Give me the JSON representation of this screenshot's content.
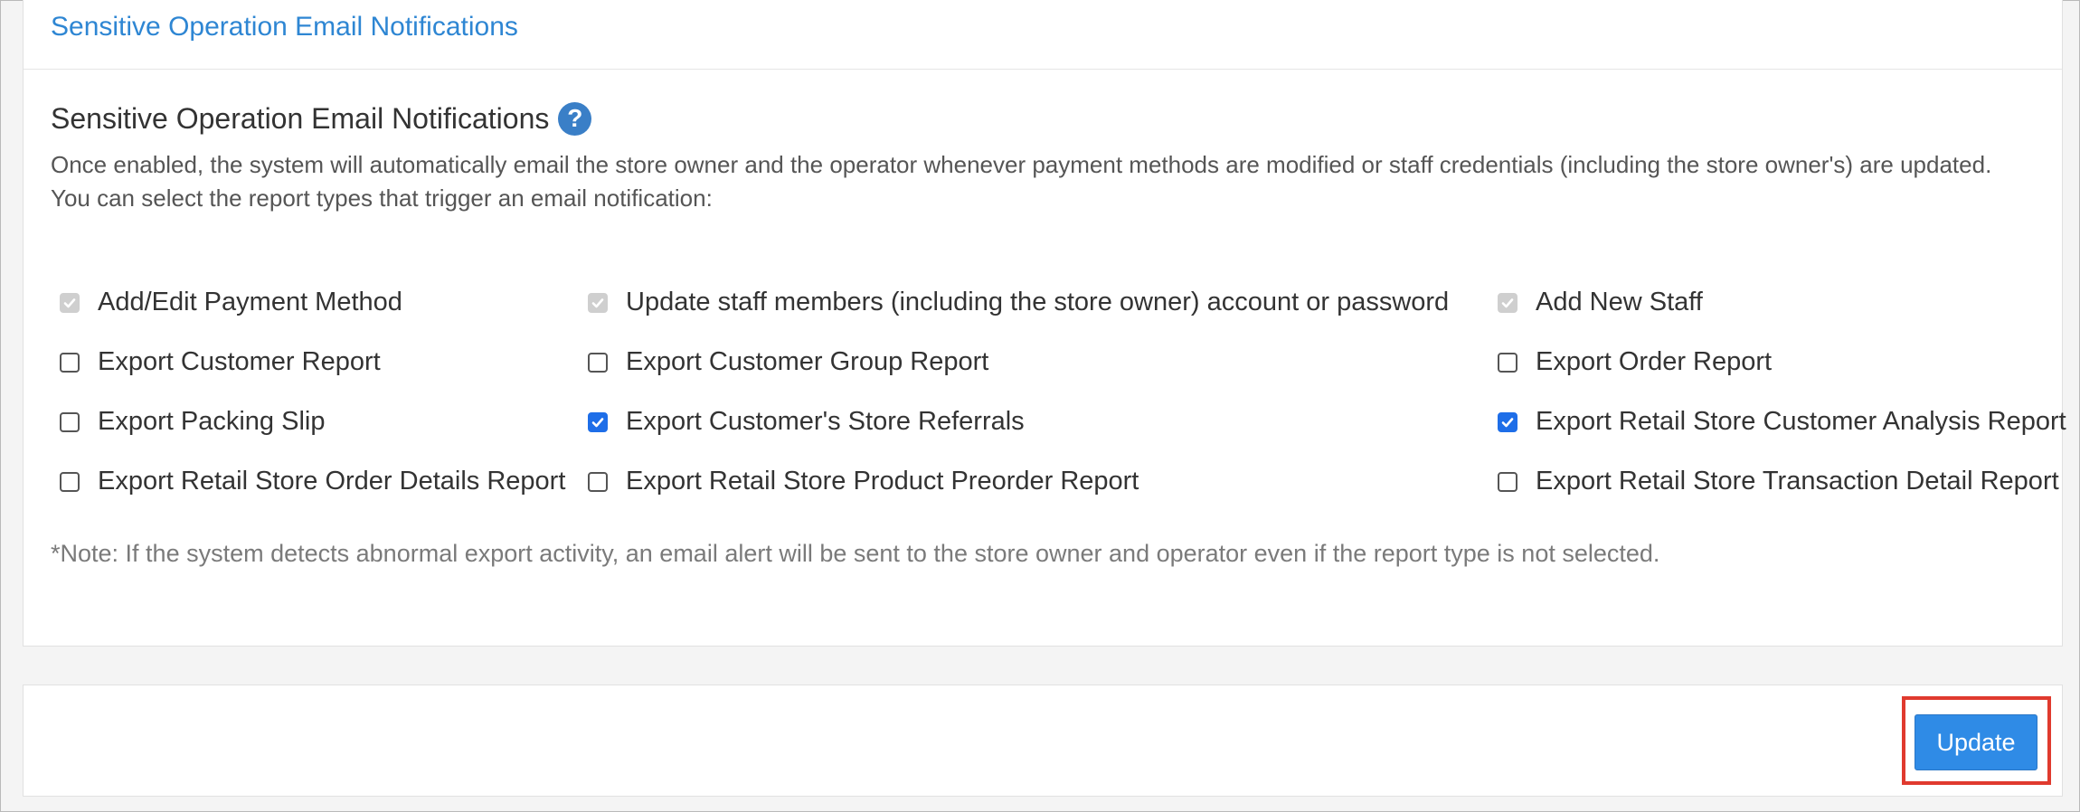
{
  "panel": {
    "title": "Sensitive Operation Email Notifications"
  },
  "section": {
    "title": "Sensitive Operation Email Notifications",
    "help_icon": "question-circle-icon",
    "description_line1": "Once enabled, the system will automatically email the store owner and the operator whenever payment methods are modified or staff credentials (including the store owner's) are updated.",
    "description_line2": "You can select the report types that trigger an email notification:"
  },
  "options": [
    {
      "label": "Add/Edit Payment Method",
      "checked": true,
      "disabled": true
    },
    {
      "label": "Update staff members (including the store owner) account or password",
      "checked": true,
      "disabled": true
    },
    {
      "label": "Add New Staff",
      "checked": true,
      "disabled": true
    },
    {
      "label": "Export Customer Report",
      "checked": false,
      "disabled": false
    },
    {
      "label": "Export Customer Group Report",
      "checked": false,
      "disabled": false
    },
    {
      "label": "Export Order Report",
      "checked": false,
      "disabled": false
    },
    {
      "label": "Export Packing Slip",
      "checked": false,
      "disabled": false
    },
    {
      "label": "Export Customer's Store Referrals",
      "checked": true,
      "disabled": false
    },
    {
      "label": "Export Retail Store Customer Analysis Report",
      "checked": true,
      "disabled": false
    },
    {
      "label": "Export Retail Store Order Details Report",
      "checked": false,
      "disabled": false
    },
    {
      "label": "Export Retail Store Product Preorder Report",
      "checked": false,
      "disabled": false
    },
    {
      "label": "Export Retail Store Transaction Detail Report",
      "checked": false,
      "disabled": false
    }
  ],
  "note": "*Note: If the system detects abnormal export activity, an email alert will be sent to the store owner and operator even if the report type is not selected.",
  "footer": {
    "update_label": "Update"
  },
  "colors": {
    "title": "#2e86d3",
    "checkbox_checked": "#1e6ee8",
    "checkbox_disabled": "#cfcfcf",
    "button": "#2f8be6",
    "highlight": "#e03a2e"
  }
}
